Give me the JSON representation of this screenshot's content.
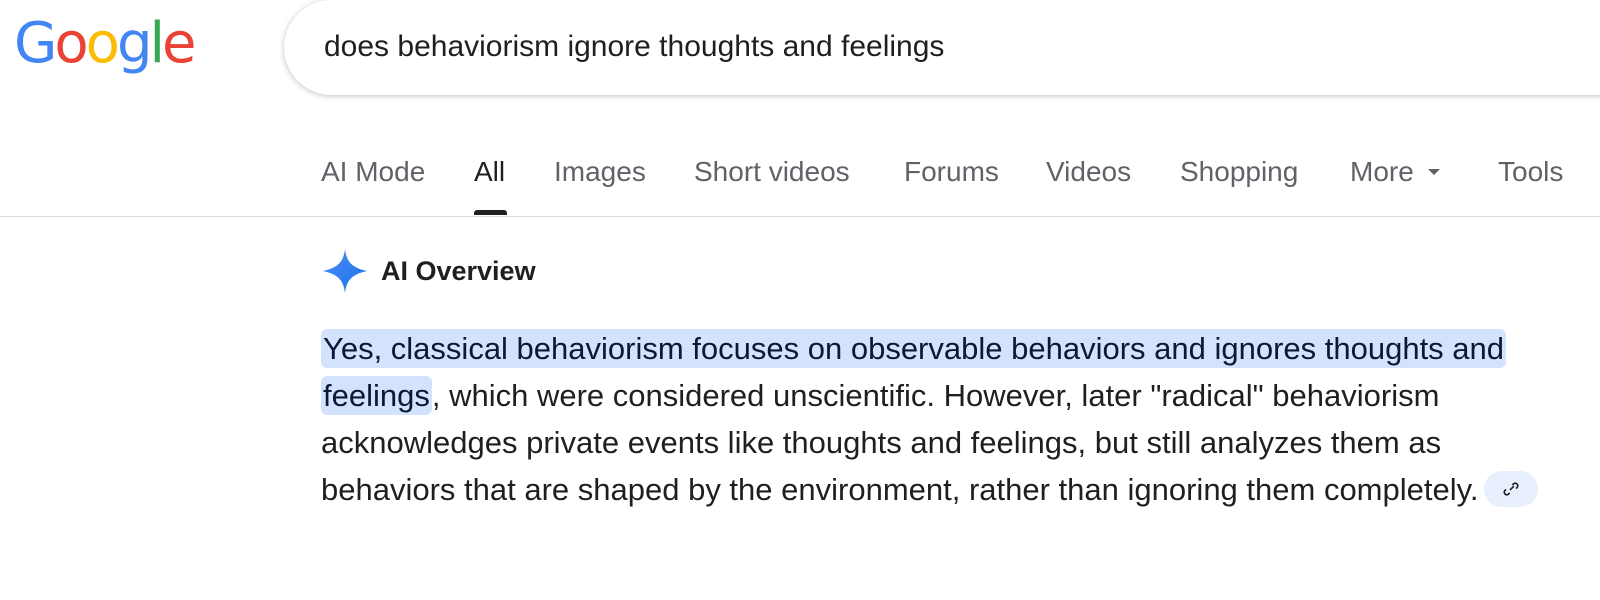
{
  "logo": {
    "letters": [
      {
        "char": "G",
        "color": "#4285f4"
      },
      {
        "char": "o",
        "color": "#ea4335"
      },
      {
        "char": "o",
        "color": "#fbbc05"
      },
      {
        "char": "g",
        "color": "#4285f4"
      },
      {
        "char": "l",
        "color": "#34a853"
      },
      {
        "char": "e",
        "color": "#ea4335"
      }
    ]
  },
  "search": {
    "query": "does behaviorism ignore thoughts and feelings"
  },
  "tabs": [
    {
      "label": "AI Mode",
      "active": false
    },
    {
      "label": "All",
      "active": true
    },
    {
      "label": "Images",
      "active": false
    },
    {
      "label": "Short videos",
      "active": false
    },
    {
      "label": "Forums",
      "active": false
    },
    {
      "label": "Videos",
      "active": false
    },
    {
      "label": "Shopping",
      "active": false
    },
    {
      "label": "More",
      "active": false,
      "has_dropdown": true
    },
    {
      "label": "Tools",
      "active": false
    }
  ],
  "ai_overview": {
    "title": "AI Overview",
    "icon": "gemini-spark-icon",
    "accent_color": "#4285f4",
    "answer_highlight": "Yes, classical behaviorism focuses on observable behaviors and ignores thoughts and feelings",
    "answer_rest": ", which were considered unscientific. However, later \"radical\" behaviorism acknowledges private events like thoughts and feelings, but still analyzes them as behaviors that are shaped by the environment, rather than ignoring them completely.",
    "source_chip_icon": "link-icon",
    "highlight_color": "#d3e3fd"
  }
}
